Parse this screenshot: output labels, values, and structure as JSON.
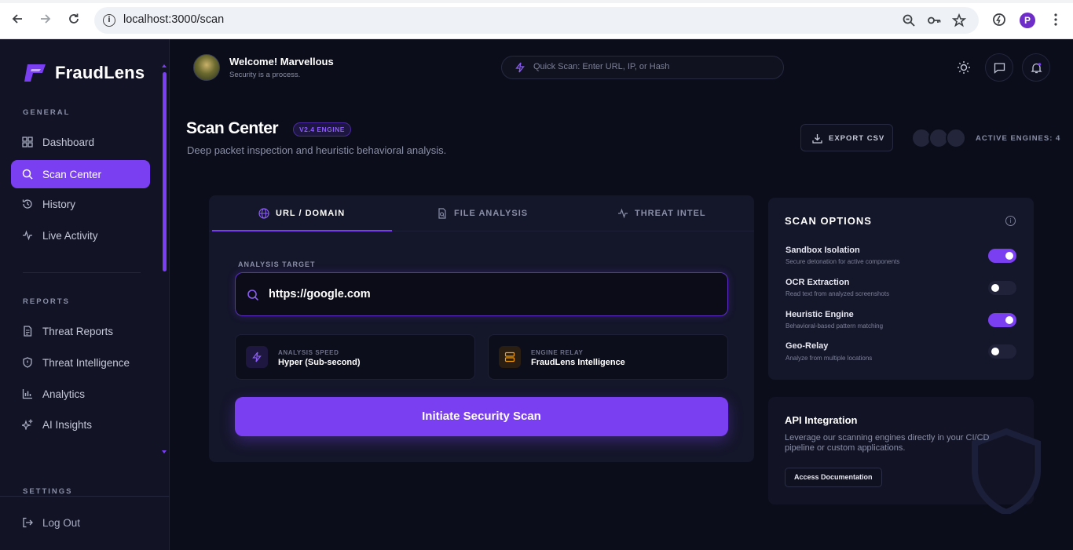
{
  "browser": {
    "url": "localhost:3000/scan",
    "profile_initial": "P"
  },
  "brand": {
    "name": "FraudLens",
    "accent": "#7b3ff2"
  },
  "sidebar": {
    "sections": {
      "general": "GENERAL",
      "reports": "REPORTS",
      "settings": "SETTINGS"
    },
    "general_items": [
      {
        "label": "Dashboard",
        "icon": "grid-icon"
      },
      {
        "label": "Scan Center",
        "icon": "search-icon",
        "active": true
      },
      {
        "label": "History",
        "icon": "history-icon"
      },
      {
        "label": "Live Activity",
        "icon": "activity-icon"
      }
    ],
    "report_items": [
      {
        "label": "Threat Reports",
        "icon": "document-icon"
      },
      {
        "label": "Threat Intelligence",
        "icon": "shield-icon"
      },
      {
        "label": "Analytics",
        "icon": "bar-chart-icon"
      },
      {
        "label": "AI Insights",
        "icon": "sparkles-icon"
      }
    ],
    "logout": "Log Out"
  },
  "topbar": {
    "welcome": "Welcome! Marvellous",
    "subtitle": "Security is a process.",
    "quick_scan_placeholder": "Quick Scan: Enter URL, IP, or Hash"
  },
  "header": {
    "title": "Scan Center",
    "badge": "V2.4 ENGINE",
    "subtitle": "Deep packet inspection and heuristic behavioral analysis.",
    "export_label": "EXPORT CSV",
    "active_engines": "ACTIVE ENGINES: 4"
  },
  "scan": {
    "tabs": [
      {
        "label": "URL / DOMAIN",
        "active": true
      },
      {
        "label": "FILE ANALYSIS"
      },
      {
        "label": "THREAT INTEL"
      }
    ],
    "field_label": "ANALYSIS TARGET",
    "target_value": "https://google.com",
    "speed_label": "ANALYSIS SPEED",
    "speed_value": "Hyper (Sub-second)",
    "relay_label": "ENGINE RELAY",
    "relay_value": "FraudLens Intelligence",
    "button": "Initiate Security Scan"
  },
  "options": {
    "title": "SCAN OPTIONS",
    "items": [
      {
        "name": "Sandbox Isolation",
        "desc": "Secure detonation for active components",
        "enabled": true
      },
      {
        "name": "OCR Extraction",
        "desc": "Read text from analyzed screenshots",
        "enabled": false
      },
      {
        "name": "Heuristic Engine",
        "desc": "Behavioral-based pattern matching",
        "enabled": true
      },
      {
        "name": "Geo-Relay",
        "desc": "Analyze from multiple locations",
        "enabled": false
      }
    ]
  },
  "api": {
    "title": "API Integration",
    "text": "Leverage our scanning engines directly in your CI/CD pipeline or custom applications.",
    "button": "Access Documentation"
  }
}
